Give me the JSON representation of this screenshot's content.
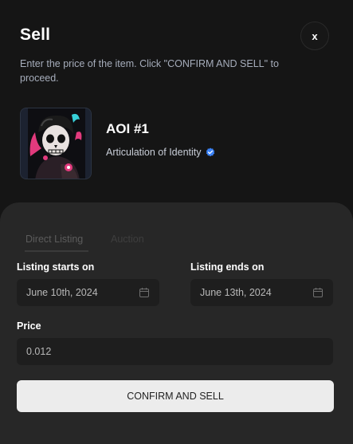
{
  "header": {
    "title": "Sell",
    "close_label": "x",
    "subtitle": "Enter the price of the item. Click \"CONFIRM AND SELL\" to proceed."
  },
  "item": {
    "name": "AOI #1",
    "collection": "Articulation of Identity",
    "verified": true
  },
  "tabs": [
    {
      "label": "Direct Listing",
      "active": true
    },
    {
      "label": "Auction",
      "active": false
    }
  ],
  "form": {
    "start_label": "Listing starts on",
    "start_value": "June 10th, 2024",
    "end_label": "Listing ends on",
    "end_value": "June 13th, 2024",
    "price_label": "Price",
    "price_value": "0.012",
    "confirm_label": "CONFIRM AND SELL"
  },
  "icons": {
    "close": "close-icon",
    "verified": "verified-badge-icon",
    "calendar": "calendar-icon"
  },
  "colors": {
    "background": "#151515",
    "panel": "#272727",
    "field": "#1e1e1e",
    "verified": "#3b82f6",
    "button": "#ececec"
  }
}
